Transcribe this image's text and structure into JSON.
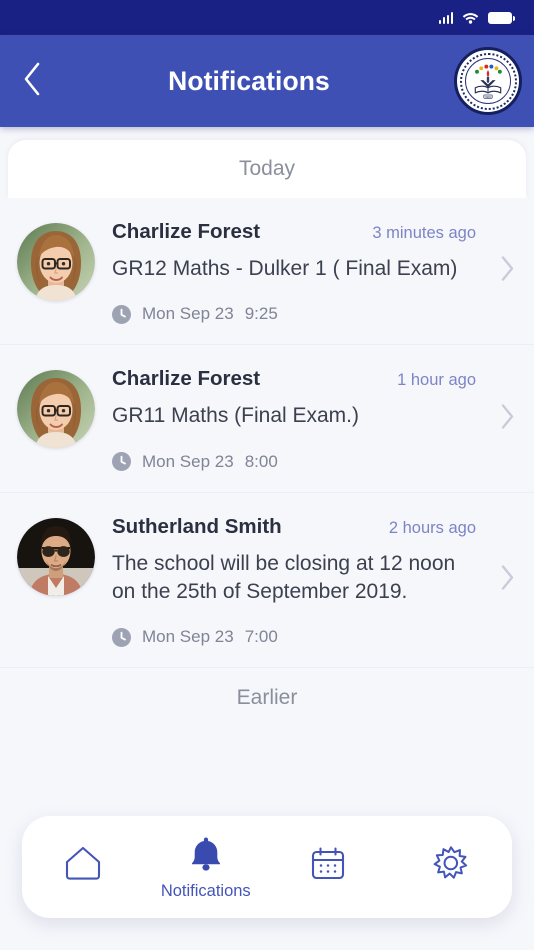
{
  "status_bar": {
    "signal_icon": "signal-bars-icon",
    "wifi_icon": "wifi-icon",
    "battery_icon": "battery-icon"
  },
  "header": {
    "back_icon": "back-chevron-icon",
    "title": "Notifications",
    "logo_icon": "school-crest-logo"
  },
  "colors": {
    "status_bar": "#1a2184",
    "header": "#3e50b4",
    "page_background": "#f6f7fb",
    "card": "#ffffff",
    "accent": "#3f51b5",
    "timestamp": "#7d84c6",
    "muted_text": "#7f8496",
    "chevron": "#c9ccd8"
  },
  "sections": [
    {
      "title": "Today"
    },
    {
      "title": "Earlier"
    }
  ],
  "notifications": [
    {
      "sender": "Charlize Forest",
      "ago": "3 minutes ago",
      "message": "GR12 Maths - Dulker 1 ( Final Exam)",
      "meta_icon": "clock-icon",
      "date": "Mon Sep 23",
      "time": "9:25",
      "chevron_icon": "chevron-right-icon",
      "avatar": "woman-with-glasses-avatar"
    },
    {
      "sender": "Charlize Forest",
      "ago": "1 hour ago",
      "message": "GR11 Maths (Final Exam.)",
      "meta_icon": "clock-icon",
      "date": "Mon Sep 23",
      "time": "8:00",
      "chevron_icon": "chevron-right-icon",
      "avatar": "woman-with-glasses-avatar"
    },
    {
      "sender": "Sutherland Smith",
      "ago": "2 hours ago",
      "message": "The school will be closing at 12 noon on the 25th of September 2019.",
      "meta_icon": "clock-icon",
      "date": "Mon Sep 23",
      "time": "7:00",
      "chevron_icon": "chevron-right-icon",
      "avatar": "man-with-sunglasses-avatar"
    }
  ],
  "bottom_nav": {
    "items": [
      {
        "icon": "home-icon",
        "label": "",
        "active": false
      },
      {
        "icon": "bell-icon",
        "label": "Notifications",
        "active": true
      },
      {
        "icon": "calendar-icon",
        "label": "",
        "active": false
      },
      {
        "icon": "settings-gear-icon",
        "label": "",
        "active": false
      }
    ]
  }
}
